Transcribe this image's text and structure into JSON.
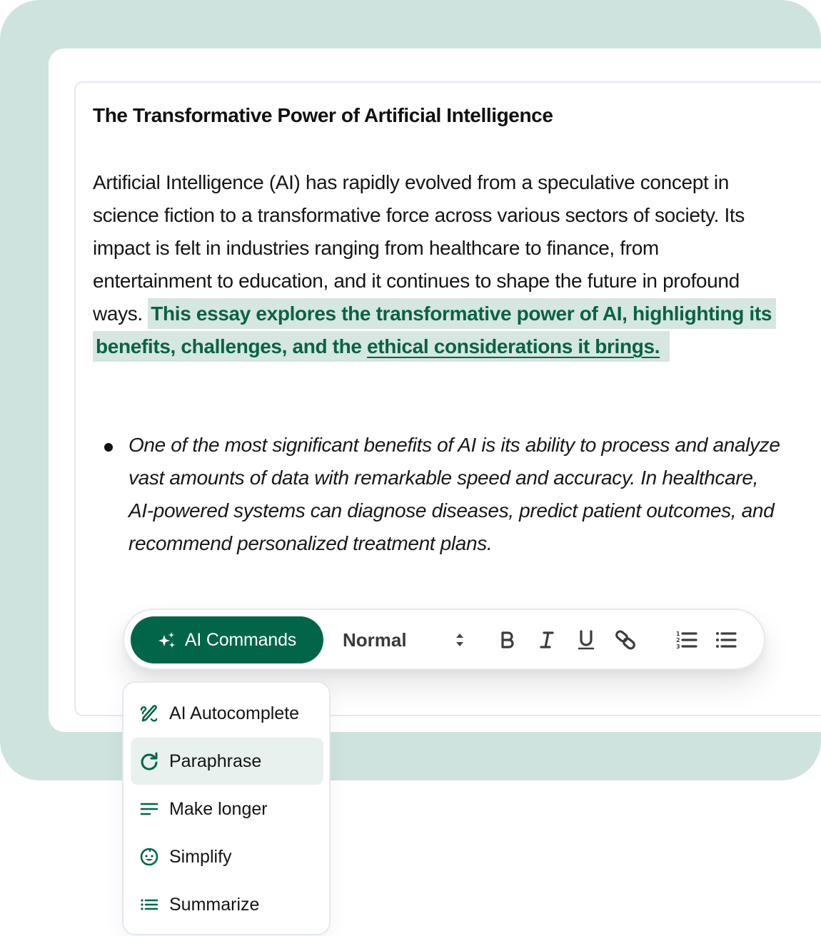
{
  "document": {
    "title": "The Transformative Power of Artificial Intelligence",
    "paragraph": {
      "plain": "Artificial Intelligence (AI) has rapidly evolved from a speculative concept in science fiction to a transformative force across various sectors of society. Its impact is felt in industries ranging from healthcare to finance, from entertainment to education, and it continues to shape the future in profound ways. ",
      "highlight_lead": "This essay explores the transformative power of AI, highlighting its benefits, challenges, and the ",
      "highlight_underlined": "ethical considerations it brings."
    },
    "bullets": [
      "One of the most significant benefits of AI is its ability to process and analyze vast amounts of data with remarkable speed and accuracy. In healthcare, AI-powered systems can diagnose diseases, predict patient outcomes, and recommend personalized treatment plans."
    ]
  },
  "toolbar": {
    "ai_commands_label": "AI Commands",
    "ai_commands_icon": "sparkles-icon",
    "text_style_value": "Normal",
    "buttons": [
      {
        "name": "bold",
        "icon": "bold-icon"
      },
      {
        "name": "italic",
        "icon": "italic-icon"
      },
      {
        "name": "underline",
        "icon": "underline-icon"
      },
      {
        "name": "link",
        "icon": "link-icon"
      },
      {
        "name": "ordered-list",
        "icon": "ordered-list-icon"
      },
      {
        "name": "bullet-list",
        "icon": "bullet-list-icon"
      }
    ]
  },
  "ai_menu": {
    "items": [
      {
        "label": "AI Autocomplete",
        "icon": "pencil-squiggle-icon",
        "active": false
      },
      {
        "label": "Paraphrase",
        "icon": "refresh-icon",
        "active": true
      },
      {
        "label": "Make longer",
        "icon": "text-lines-icon",
        "active": false
      },
      {
        "label": "Simplify",
        "icon": "baby-face-icon",
        "active": false
      },
      {
        "label": "Summarize",
        "icon": "list-icon",
        "active": false
      }
    ]
  },
  "colors": {
    "brand_green": "#02654a",
    "background_mint": "#cee3dd",
    "highlight_bg": "#d6e6e1",
    "menu_active_bg": "#e8f1ee"
  }
}
